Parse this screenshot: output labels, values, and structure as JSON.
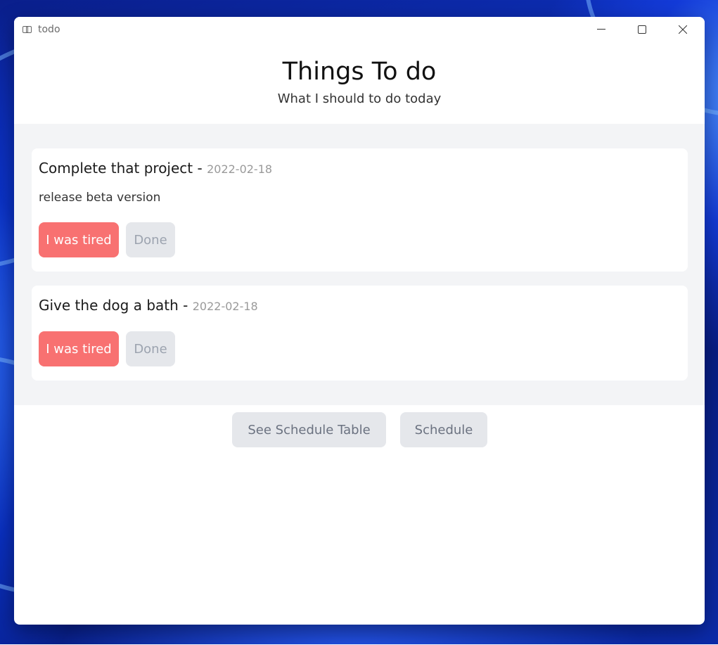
{
  "window": {
    "title": "todo"
  },
  "header": {
    "title": "Things To do",
    "subtitle": "What I should to do today"
  },
  "todos": [
    {
      "title": "Complete that project",
      "separator": " - ",
      "date": "2022-02-18",
      "description": "release beta version",
      "tired_label": "I was tired",
      "done_label": "Done"
    },
    {
      "title": "Give the dog a bath",
      "separator": " - ",
      "date": "2022-02-18",
      "description": "",
      "tired_label": "I was tired",
      "done_label": "Done"
    }
  ],
  "footer": {
    "schedule_table_label": "See Schedule Table",
    "schedule_label": "Schedule"
  },
  "colors": {
    "tired_button": "#f87171",
    "neutral_button": "#e5e7eb",
    "list_background": "#f3f4f6"
  },
  "icons": {
    "app": "app-icon",
    "minimize": "minimize-icon",
    "maximize": "maximize-icon",
    "close": "close-icon"
  }
}
